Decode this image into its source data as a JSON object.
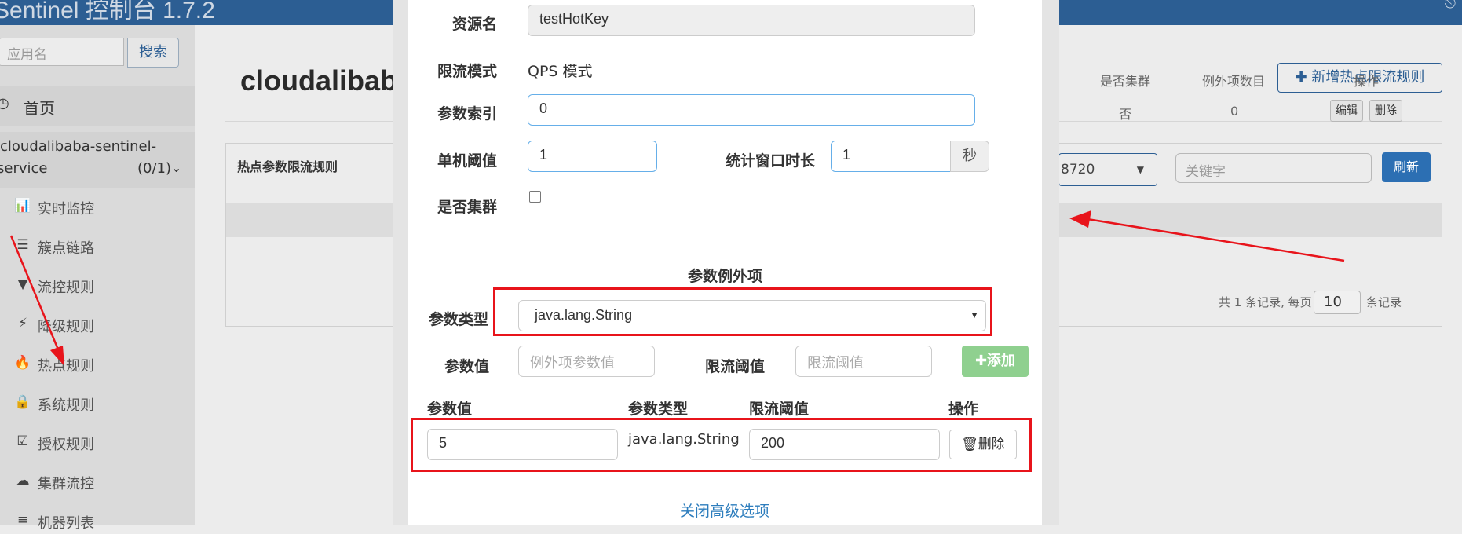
{
  "app": {
    "title": "Sentinel 控制台 1.7.2",
    "logout_icon": "logout-icon"
  },
  "sidebar": {
    "search_placeholder": "应用名",
    "search_button": "搜索",
    "home": "首页",
    "app_name_line1": "cloudalibaba-sentinel-",
    "app_name_line2": "service",
    "app_count": "(0/1)",
    "items": [
      {
        "icon": "bar-chart-icon",
        "glyph": "📊",
        "label": "实时监控"
      },
      {
        "icon": "list-icon",
        "glyph": "☰",
        "label": "簇点链路"
      },
      {
        "icon": "filter-icon",
        "glyph": "▼",
        "label": "流控规则"
      },
      {
        "icon": "flash-icon",
        "glyph": "⚡",
        "label": "降级规则"
      },
      {
        "icon": "fire-icon",
        "glyph": "🔥",
        "label": "热点规则"
      },
      {
        "icon": "lock-icon",
        "glyph": "🔒",
        "label": "系统规则"
      },
      {
        "icon": "check-square-icon",
        "glyph": "☑",
        "label": "授权规则"
      },
      {
        "icon": "cloud-icon",
        "glyph": "☁",
        "label": "集群流控"
      },
      {
        "icon": "list-icon",
        "glyph": "≡",
        "label": "机器列表"
      }
    ]
  },
  "main": {
    "title": "cloudalibaba",
    "add_rule_button": "新增热点限流规则",
    "panel_title": "热点参数限流规则",
    "host_select": "8720",
    "keyword_placeholder": "关键字",
    "refresh_button": "刷新",
    "columns": [
      "是否集群",
      "例外项数目",
      "操作"
    ],
    "row": {
      "cluster": "否",
      "exceptions": "0",
      "edit": "编辑",
      "delete": "删除"
    },
    "pager_prefix": "共 1 条记录, 每页",
    "page_size": "10",
    "pager_suffix": "条记录"
  },
  "modal": {
    "resource_label": "资源名",
    "resource_value": "testHotKey",
    "mode_label": "限流模式",
    "mode_value": "QPS 模式",
    "param_index_label": "参数索引",
    "param_index_value": "0",
    "threshold_label": "单机阈值",
    "threshold_value": "1",
    "window_label": "统计窗口时长",
    "window_value": "1",
    "window_unit": "秒",
    "cluster_label": "是否集群",
    "section_title": "参数例外项",
    "param_type_label": "参数类型",
    "param_type_value": "java.lang.String",
    "param_value_label": "参数值",
    "param_value_placeholder": "例外项参数值",
    "limit_label": "限流阈值",
    "limit_placeholder": "限流阈值",
    "add_button": "添加",
    "table_headers": [
      "参数值",
      "参数类型",
      "限流阈值",
      "操作"
    ],
    "table_row": {
      "value": "5",
      "type": "java.lang.String",
      "limit": "200",
      "delete": "删除"
    },
    "close_advanced": "关闭高级选项"
  },
  "annotation_color": "#e8141b"
}
